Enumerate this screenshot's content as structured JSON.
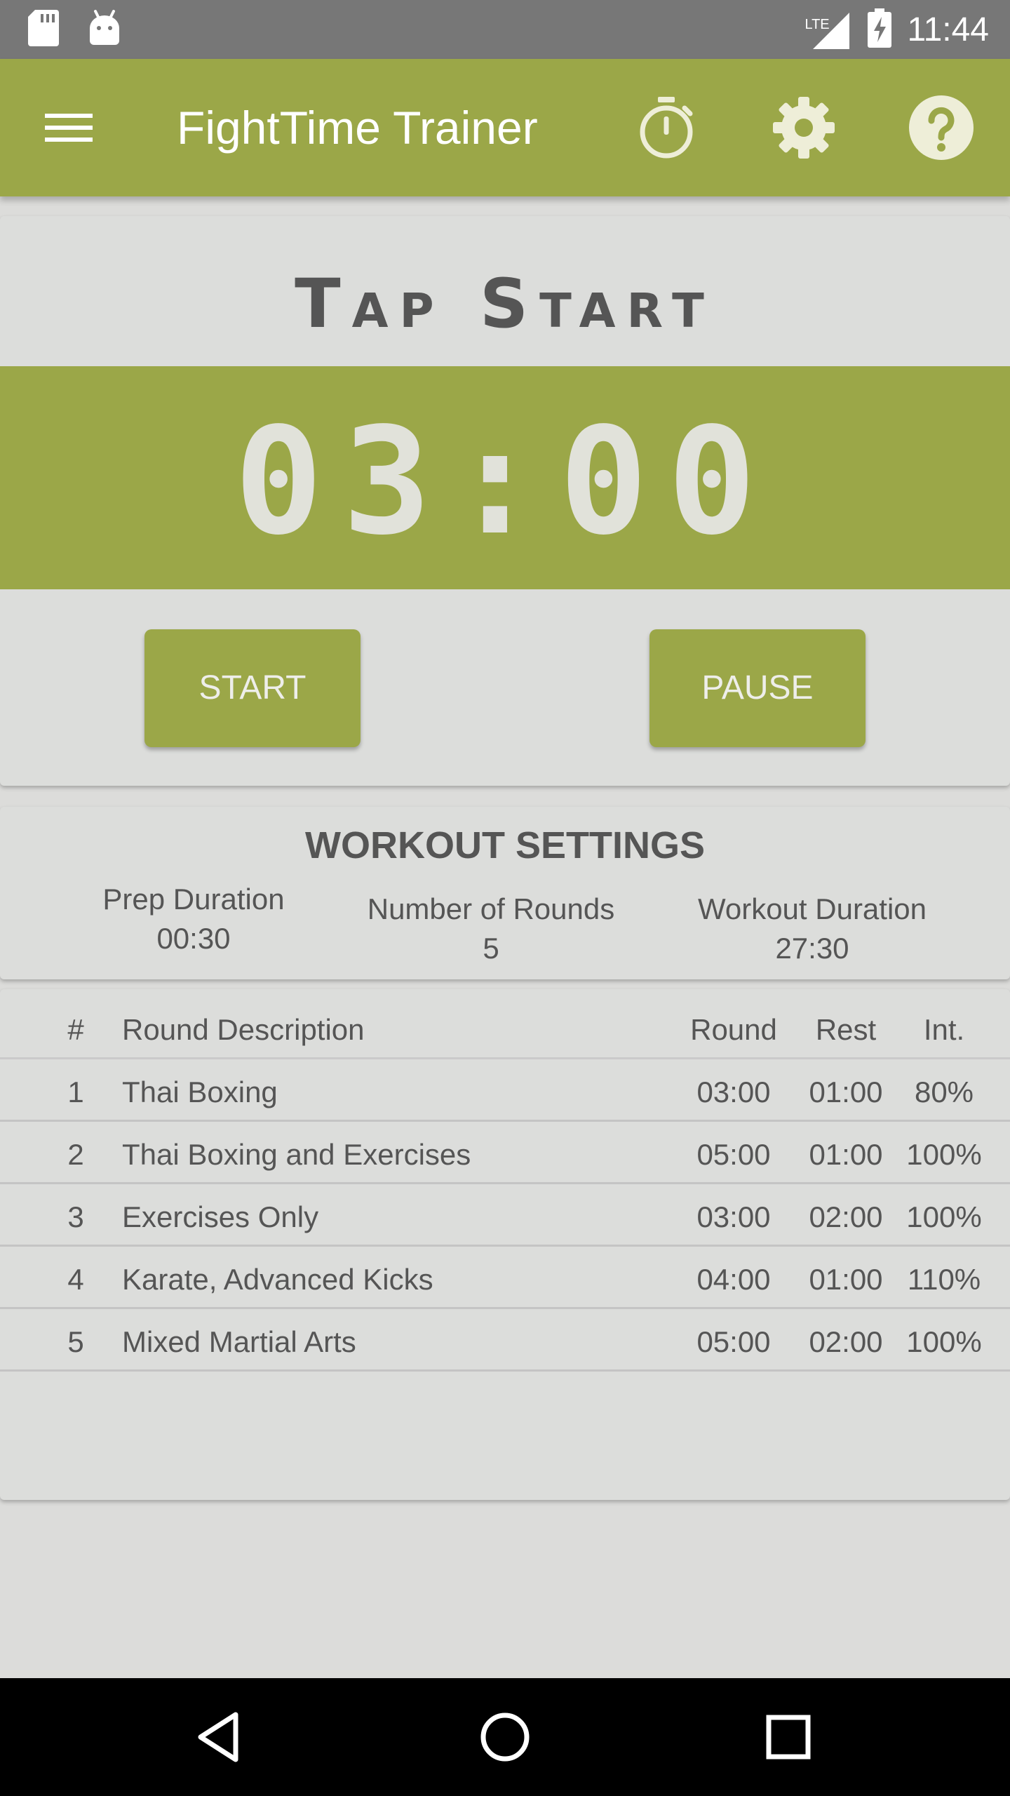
{
  "status_bar": {
    "time": "11:44",
    "network": "LTE",
    "icons": [
      "sd-card-icon",
      "android-icon",
      "signal-icon",
      "battery-charging-icon"
    ]
  },
  "app_bar": {
    "title": "FightTime Trainer",
    "icons": [
      "menu-icon",
      "stopwatch-icon",
      "gear-icon",
      "help-icon"
    ]
  },
  "timer": {
    "prompt": "Tap Start",
    "display": "03:00",
    "start_label": "START",
    "pause_label": "PAUSE"
  },
  "settings": {
    "title": "WORKOUT SETTINGS",
    "prep_label": "Prep Duration",
    "prep_value": "00:30",
    "rounds_label": "Number of Rounds",
    "rounds_value": "5",
    "duration_label": "Workout Duration",
    "duration_value": "27:30"
  },
  "rounds_table": {
    "headers": {
      "num": "#",
      "desc": "Round Description",
      "round": "Round",
      "rest": "Rest",
      "int": "Int."
    },
    "rows": [
      {
        "num": "1",
        "desc": "Thai Boxing",
        "round": "03:00",
        "rest": "01:00",
        "int": "80%"
      },
      {
        "num": "2",
        "desc": "Thai Boxing and Exercises",
        "round": "05:00",
        "rest": "01:00",
        "int": "100%"
      },
      {
        "num": "3",
        "desc": "Exercises Only",
        "round": "03:00",
        "rest": "02:00",
        "int": "100%"
      },
      {
        "num": "4",
        "desc": "Karate, Advanced Kicks",
        "round": "04:00",
        "rest": "01:00",
        "int": "110%"
      },
      {
        "num": "5",
        "desc": "Mixed Martial Arts",
        "round": "05:00",
        "rest": "02:00",
        "int": "100%"
      }
    ]
  },
  "nav_bar": {
    "icons": [
      "back-icon",
      "home-icon",
      "recents-icon"
    ]
  },
  "colors": {
    "accent": "#9ba748",
    "status_bar": "#777777",
    "card": "#dcdddb",
    "text": "#555555"
  }
}
